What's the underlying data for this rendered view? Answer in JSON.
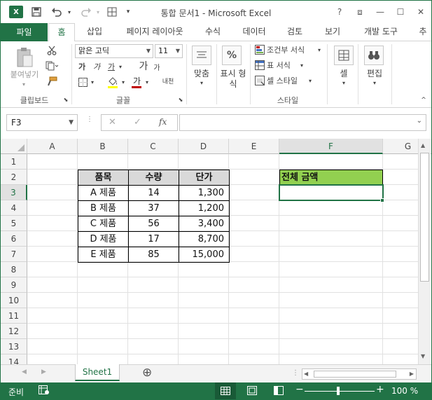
{
  "app": {
    "title": "통합 문서1 - Microsoft Excel",
    "logo_letter": "X",
    "window_buttons": [
      "?",
      "⧈",
      "—",
      "☐",
      "✕"
    ]
  },
  "tabs": {
    "file": "파일",
    "items": [
      "홈",
      "삽입",
      "페이지 레이아웃",
      "수식",
      "데이터",
      "검토",
      "보기",
      "개발 도구",
      "추"
    ]
  },
  "ribbon": {
    "clipboard": {
      "paste": "붙여넣기",
      "label": "클립보드"
    },
    "font": {
      "name": "맑은 고딕",
      "size": "11",
      "bold": "가",
      "italic": "가",
      "underline": "가",
      "grow": "가",
      "shrink": "가",
      "phonetic": "내천",
      "label": "글꼴"
    },
    "align": {
      "label": "맞춤"
    },
    "number": {
      "symbol": "%",
      "label": "표시 형",
      "label2": "식"
    },
    "styles": {
      "conditional": "조건부 서식",
      "table": "표 서식",
      "cell_style": "셀 스타일",
      "label": "스타일"
    },
    "cells": {
      "label": "셀"
    },
    "editing": {
      "label": "편집"
    }
  },
  "formula_bar": {
    "name_box": "F3",
    "cancel": "✕",
    "enter": "✓",
    "fx": "fx",
    "formula": ""
  },
  "grid": {
    "columns": [
      "A",
      "B",
      "C",
      "D",
      "E",
      "F",
      "G"
    ],
    "rows": [
      "1",
      "2",
      "3",
      "4",
      "5",
      "6",
      "7",
      "8",
      "9",
      "10",
      "11",
      "12",
      "13",
      "14"
    ],
    "selected_col": "F",
    "selected_row": "3"
  },
  "table": {
    "headers": [
      "품목",
      "수량",
      "단가"
    ],
    "rows": [
      [
        "A 제품",
        "14",
        "1,300"
      ],
      [
        "B 제품",
        "37",
        "1,200"
      ],
      [
        "C 제품",
        "56",
        "3,400"
      ],
      [
        "D 제품",
        "17",
        "8,700"
      ],
      [
        "E 제품",
        "85",
        "15,000"
      ]
    ],
    "header_bg": "#d9d9d9"
  },
  "total": {
    "label": "전체 금액",
    "bg": "#92d050",
    "value": ""
  },
  "sheets": {
    "active": "Sheet1",
    "add": "⊕"
  },
  "status": {
    "ready": "준비",
    "zoom": "100 %"
  },
  "colors": {
    "accent": "#217346"
  }
}
